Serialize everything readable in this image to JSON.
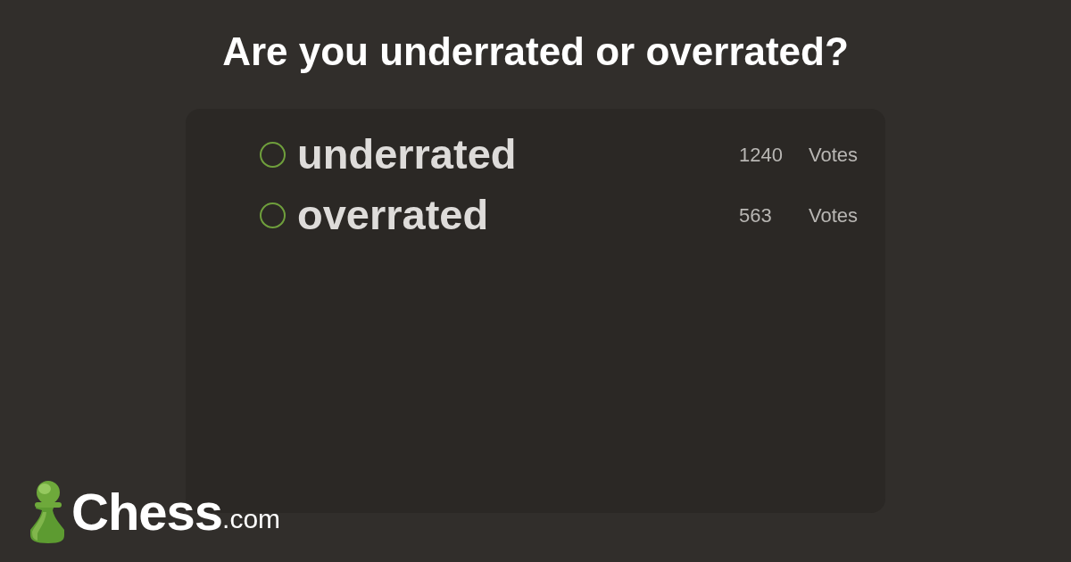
{
  "title": "Are you underrated or overrated?",
  "poll": {
    "options": [
      {
        "label": "underrated",
        "selected": false,
        "votes": "1240",
        "votes_label": "Votes"
      },
      {
        "label": "overrated",
        "selected": false,
        "votes": "563",
        "votes_label": "Votes"
      }
    ]
  },
  "logo": {
    "name": "Chess",
    "suffix": ".com"
  }
}
